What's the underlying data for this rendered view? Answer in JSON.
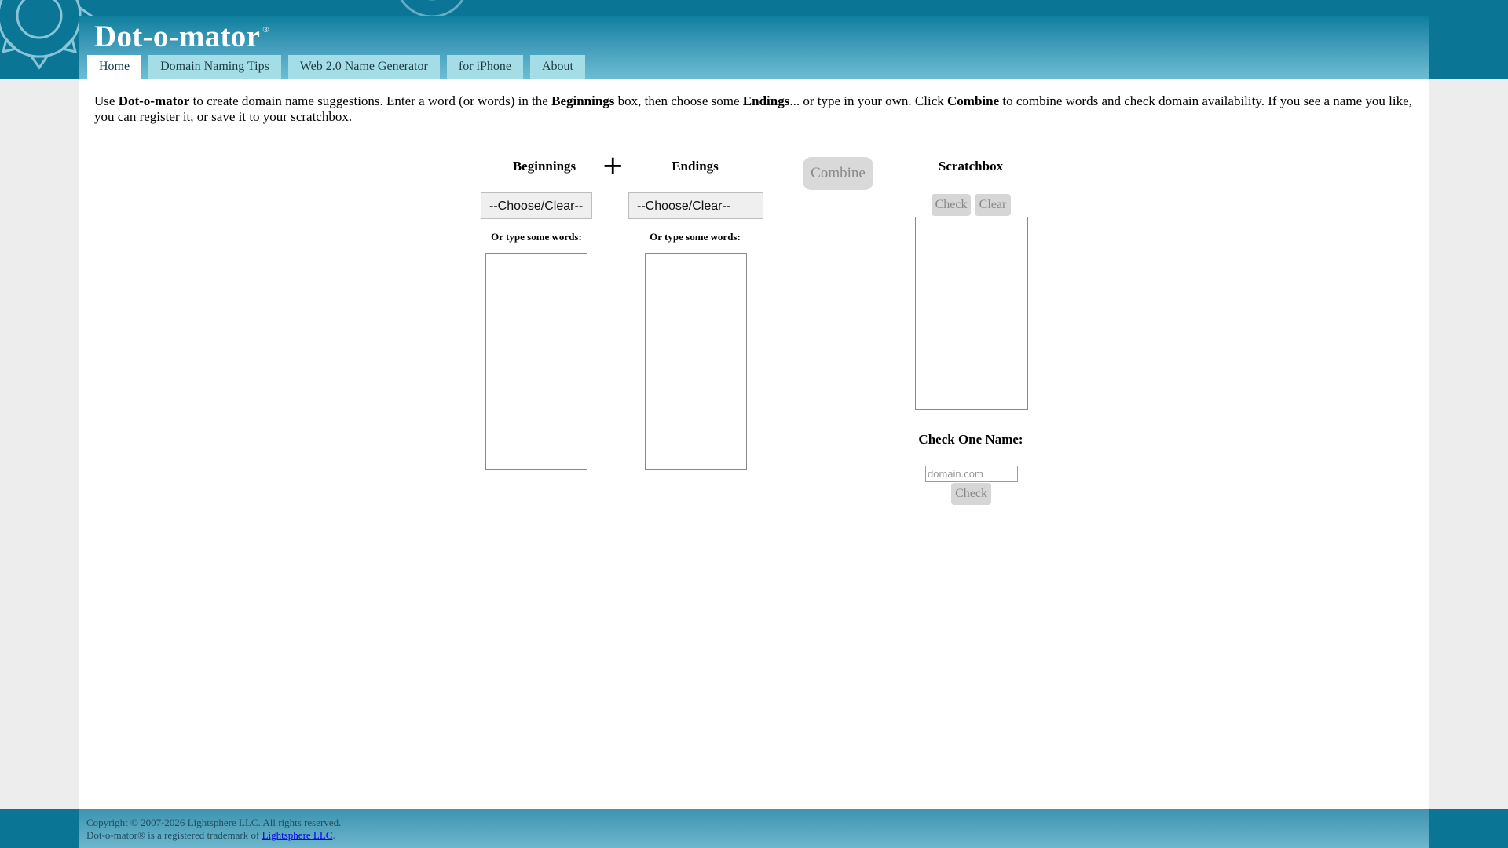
{
  "site": {
    "logo": "Dot-o-mator",
    "logo_mark": "®"
  },
  "nav": {
    "tabs": [
      {
        "label": "Home",
        "active": true
      },
      {
        "label": "Domain Naming Tips",
        "active": false
      },
      {
        "label": "Web 2.0 Name Generator",
        "active": false
      },
      {
        "label": "for iPhone",
        "active": false
      },
      {
        "label": "About",
        "active": false
      }
    ]
  },
  "intro": {
    "p1": "Use ",
    "b1": "Dot-o-mator",
    "p2": " to create domain name suggestions. Enter a word (or words) in the ",
    "b2": "Beginnings",
    "p3": " box, then choose some ",
    "b3": "Endings",
    "p4": "... or type in your own. Click ",
    "b4": "Combine",
    "p5": " to combine words and check domain availability. If you see a name you like, you can register it, or save it to your scratchbox."
  },
  "beginnings": {
    "heading": "Beginnings",
    "select_value": "--Choose/Clear--",
    "subheading": "Or type some words:",
    "textarea_value": ""
  },
  "plus_symbol": "+",
  "endings": {
    "heading": "Endings",
    "select_value": "--Choose/Clear--",
    "subheading": "Or type some words:",
    "textarea_value": ""
  },
  "combine": {
    "label": "Combine"
  },
  "scratchbox": {
    "heading": "Scratchbox",
    "check_label": "Check",
    "clear_label": "Clear",
    "textarea_value": ""
  },
  "check_one": {
    "heading": "Check One Name:",
    "placeholder": "domain.com",
    "value": "",
    "check_label": "Check"
  },
  "footer": {
    "copyright": "Copyright © 2007-2026 Lightsphere LLC. All rights reserved.",
    "trademark_prefix": "Dot-o-mator® is a registered trademark of ",
    "trademark_link": "Lightsphere LLC",
    "trademark_suffix": "."
  },
  "colors": {
    "band": "#0a7595",
    "tab": "#a5dde6",
    "button_disabled": "#d9d9d9"
  }
}
